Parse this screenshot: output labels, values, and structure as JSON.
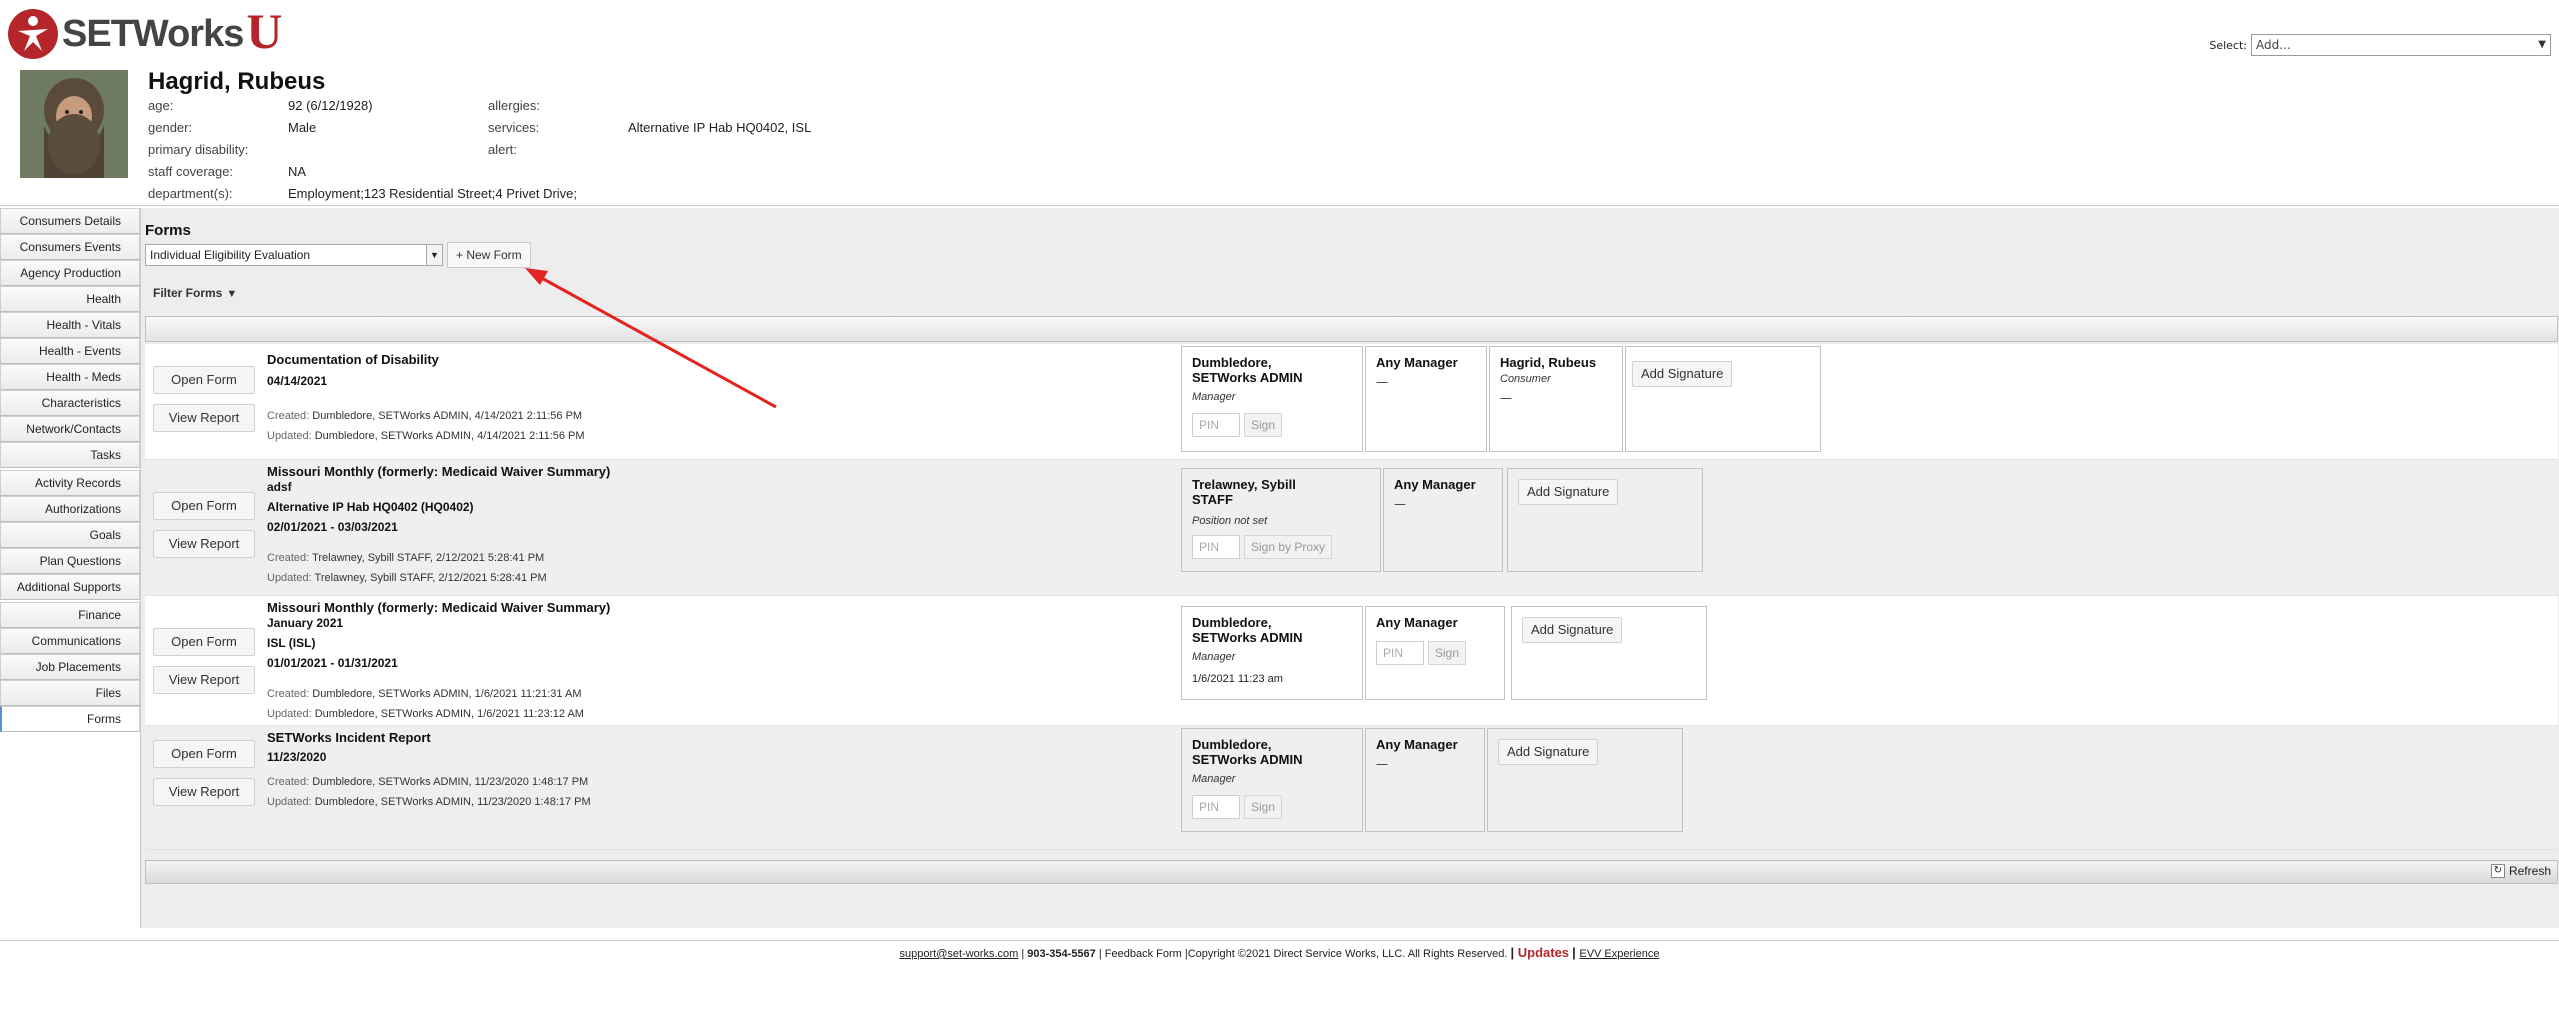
{
  "app": {
    "logo_text": "SETWorks",
    "logo_u": "U",
    "select_label": "Select:",
    "select_value": "Add..."
  },
  "consumer": {
    "name": "Hagrid, Rubeus",
    "fields": {
      "age_label": "age:",
      "age_value": "92 (6/12/1928)",
      "gender_label": "gender:",
      "gender_value": "Male",
      "primary_disability_label": "primary disability:",
      "primary_disability_value": "",
      "staff_coverage_label": "staff coverage:",
      "staff_coverage_value": "NA",
      "departments_label": "department(s):",
      "departments_value": "Employment;123 Residential Street;4 Privet Drive;",
      "allergies_label": "allergies:",
      "allergies_value": "",
      "services_label": "services:",
      "services_value": "Alternative IP Hab HQ0402, ISL",
      "alert_label": "alert:",
      "alert_value": ""
    }
  },
  "sidebar": {
    "items": [
      {
        "label": "Consumers Details"
      },
      {
        "label": "Consumers Events"
      },
      {
        "label": "Agency Production"
      },
      {
        "label": "Health"
      },
      {
        "label": "Health - Vitals"
      },
      {
        "label": "Health - Events"
      },
      {
        "label": "Health - Meds"
      },
      {
        "label": "Characteristics"
      },
      {
        "label": "Network/Contacts"
      },
      {
        "label": "Tasks"
      },
      {
        "label": "Activity Records"
      },
      {
        "label": "Authorizations"
      },
      {
        "label": "Goals"
      },
      {
        "label": "Plan Questions"
      },
      {
        "label": "Additional Supports"
      },
      {
        "label": "Finance"
      },
      {
        "label": "Communications"
      },
      {
        "label": "Job Placements"
      },
      {
        "label": "Files"
      },
      {
        "label": "Forms"
      }
    ]
  },
  "forms": {
    "title": "Forms",
    "form_type_value": "Individual Eligibility Evaluation",
    "new_form_label": "+ New Form",
    "filter_label": "Filter Forms",
    "open_form_label": "Open Form",
    "view_report_label": "View Report",
    "created_label": "Created:",
    "updated_label": "Updated:",
    "pin_placeholder": "PIN",
    "sign_label": "Sign",
    "sign_proxy_label": "Sign by Proxy",
    "add_signature_label": "Add Signature",
    "dash": "—",
    "refresh_label": "Refresh",
    "rows": [
      {
        "title": "Documentation of Disability",
        "line1": "04/14/2021",
        "created": "Dumbledore, SETWorks ADMIN, 4/14/2021 2:11:56 PM",
        "updated": "Dumbledore, SETWorks ADMIN, 4/14/2021 2:11:56 PM",
        "sig1": {
          "name": "Dumbledore, SETWorks ADMIN",
          "role": "Manager"
        },
        "sig2": {
          "name": "Any Manager"
        },
        "sig3": {
          "name": "Hagrid, Rubeus",
          "role": "Consumer"
        }
      },
      {
        "title": "Missouri Monthly (formerly: Medicaid Waiver Summary)",
        "line1": "adsf",
        "line2": "Alternative IP Hab HQ0402 (HQ0402)",
        "line3": "02/01/2021 - 03/03/2021",
        "created": "Trelawney, Sybill STAFF, 2/12/2021 5:28:41 PM",
        "updated": "Trelawney, Sybill STAFF, 2/12/2021 5:28:41 PM",
        "sig1": {
          "name": "Trelawney, Sybill STAFF",
          "role": "Position not set"
        },
        "sig2": {
          "name": "Any Manager"
        }
      },
      {
        "title": "Missouri Monthly (formerly: Medicaid Waiver Summary)",
        "line1": "January 2021",
        "line2": "ISL (ISL)",
        "line3": "01/01/2021 - 01/31/2021",
        "created": "Dumbledore, SETWorks ADMIN, 1/6/2021 11:21:31 AM",
        "updated": "Dumbledore, SETWorks ADMIN, 1/6/2021 11:23:12 AM",
        "sig1": {
          "name": "Dumbledore, SETWorks ADMIN",
          "role": "Manager",
          "date": "1/6/2021 11:23 am"
        },
        "sig2": {
          "name": "Any Manager"
        }
      },
      {
        "title": "SETWorks Incident Report",
        "line1": "11/23/2020",
        "created": "Dumbledore, SETWorks ADMIN, 11/23/2020 1:48:17 PM",
        "updated": "Dumbledore, SETWorks ADMIN, 11/23/2020 1:48:17 PM",
        "sig1": {
          "name": "Dumbledore, SETWorks ADMIN",
          "role": "Manager"
        },
        "sig2": {
          "name": "Any Manager"
        }
      }
    ]
  },
  "footer": {
    "email": "support@set-works.com",
    "phone": "903-354-5567",
    "feedback": "Feedback Form",
    "copyright": "Copyright ©2021 Direct Service Works, LLC. All Rights Reserved.",
    "updates": "Updates",
    "evv": "EVV Experience"
  },
  "colors": {
    "brand_red": "#b5262b",
    "annotation_arrow": "#e3231f"
  },
  "icons": [
    "setworks-logo-icon",
    "dropdown-arrow-icon",
    "filter-caret-icon",
    "refresh-icon",
    "annotation-arrow"
  ]
}
